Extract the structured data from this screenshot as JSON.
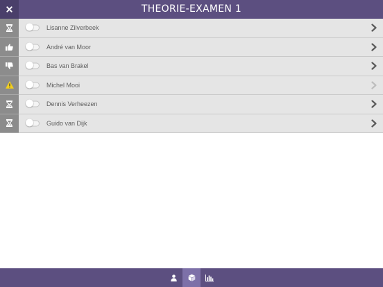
{
  "header": {
    "title": "THEORIE-EXAMEN 1",
    "close_icon": "close-icon",
    "background": "#5c4f80"
  },
  "students": [
    {
      "name": "Lisanne Zilverbeek",
      "status_icon": "hourglass-icon",
      "toggle_on": false,
      "chevron_enabled": true
    },
    {
      "name": "André van Moor",
      "status_icon": "thumbs-up-icon",
      "toggle_on": false,
      "chevron_enabled": true
    },
    {
      "name": "Bas van Brakel",
      "status_icon": "thumbs-down-icon",
      "toggle_on": false,
      "chevron_enabled": true
    },
    {
      "name": "Michel Mooi",
      "status_icon": "warning-icon",
      "toggle_on": false,
      "chevron_enabled": false
    },
    {
      "name": "Dennis Verheezen",
      "status_icon": "hourglass-icon",
      "toggle_on": false,
      "chevron_enabled": true
    },
    {
      "name": "Guido van Dijk",
      "status_icon": "hourglass-icon",
      "toggle_on": false,
      "chevron_enabled": true
    }
  ],
  "footer": {
    "tabs": [
      {
        "icon": "user-icon",
        "active": false
      },
      {
        "icon": "cube-icon",
        "active": true
      },
      {
        "icon": "bar-chart-icon",
        "active": false
      }
    ]
  },
  "colors": {
    "accent": "#5c4f80",
    "accent_active": "#7d70a8",
    "status_cell": "#8c8c8c",
    "row_bg": "#e5e5e5",
    "warning": "#f2cf1d"
  }
}
